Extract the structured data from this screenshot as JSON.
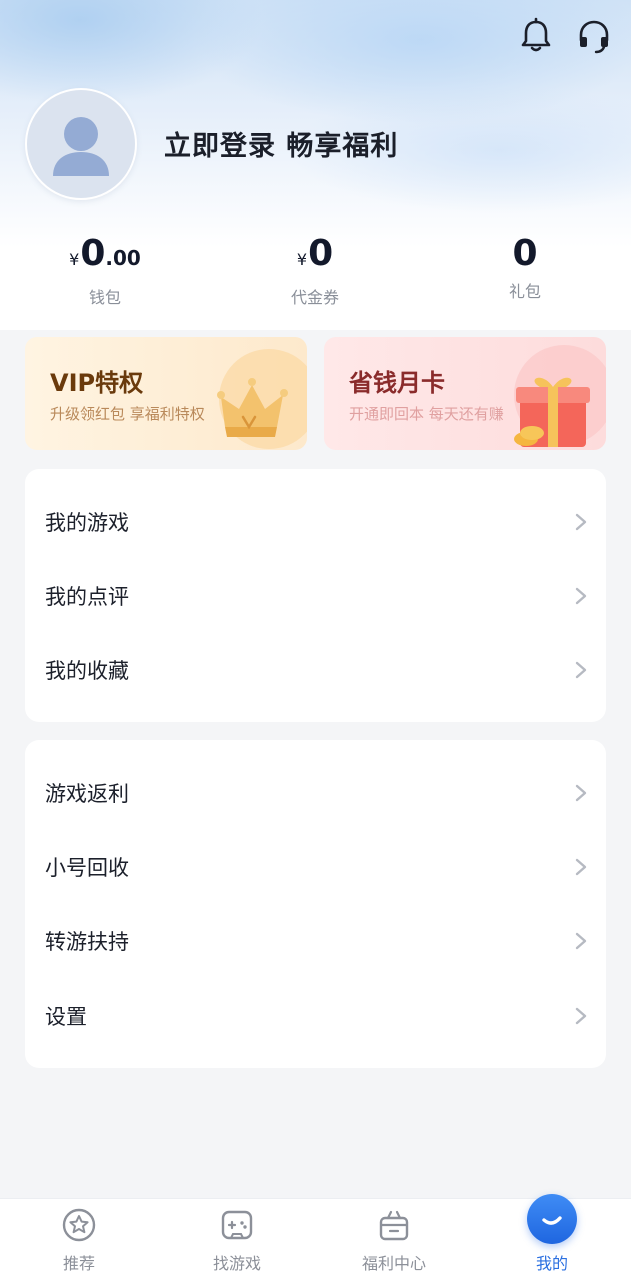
{
  "header": {
    "login_text": "立即登录 畅享福利"
  },
  "stats": [
    {
      "currency": "¥",
      "value": "0",
      "decimal": ".00",
      "label": "钱包"
    },
    {
      "currency": "¥",
      "value": "0",
      "decimal": "",
      "label": "代金券"
    },
    {
      "currency": "",
      "value": "0",
      "decimal": "",
      "label": "礼包"
    }
  ],
  "promos": {
    "vip": {
      "title": "VIP特权",
      "subtitle": "升级领红包 享福利特权"
    },
    "monthly": {
      "title": "省钱月卡",
      "subtitle": "开通即回本 每天还有赚"
    }
  },
  "menu1": [
    {
      "label": "我的游戏"
    },
    {
      "label": "我的点评"
    },
    {
      "label": "我的收藏"
    }
  ],
  "menu2": [
    {
      "label": "游戏返利"
    },
    {
      "label": "小号回收"
    },
    {
      "label": "转游扶持"
    },
    {
      "label": "设置"
    }
  ],
  "tabbar": [
    {
      "label": "推荐",
      "icon": "star-icon"
    },
    {
      "label": "找游戏",
      "icon": "gamepad-icon"
    },
    {
      "label": "福利中心",
      "icon": "gift-icon"
    },
    {
      "label": "我的",
      "icon": "profile-icon"
    }
  ],
  "colors": {
    "accent": "#2a6fe0",
    "vip_title": "#6a3a0c",
    "monthly_title": "#8a2b2b"
  }
}
